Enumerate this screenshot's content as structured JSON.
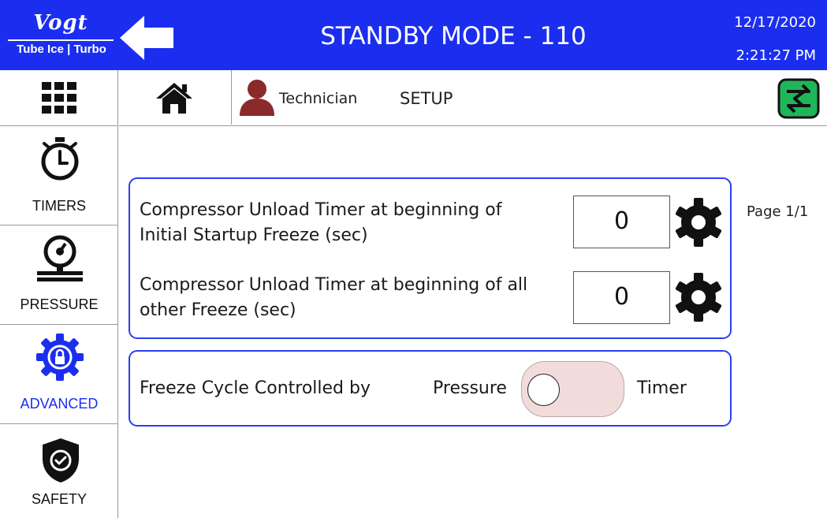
{
  "header": {
    "logo_brand": "Vogt",
    "logo_sub": "Tube Ice | Turbo",
    "title": "STANDBY MODE - 110",
    "date": "12/17/2020",
    "time": "2:21:27 PM",
    "color": "#1b2ef0"
  },
  "sidebar": {
    "grid_icon": "menu-grid-icon",
    "items": [
      {
        "label": "TIMERS",
        "icon": "stopwatch-icon",
        "selected": false
      },
      {
        "label": "PRESSURE",
        "icon": "pressure-gauge-icon",
        "selected": false
      },
      {
        "label": "ADVANCED",
        "icon": "lock-gear-icon",
        "selected": true
      },
      {
        "label": "SAFETY",
        "icon": "shield-check-icon",
        "selected": false
      }
    ]
  },
  "navbar": {
    "home_icon": "home-icon",
    "user_icon": "user-icon",
    "user_label": "Technician",
    "section_label": "SETUP",
    "swap_icon": "swap-screen-icon"
  },
  "settings": {
    "rows": [
      {
        "label_line1": "Compressor Unload Timer at beginning of",
        "label_line2": "Initial Startup Freeze (sec)",
        "value": "0"
      },
      {
        "label_line1": "Compressor Unload Timer at beginning of all",
        "label_line2": "other Freeze (sec)",
        "value": "0"
      }
    ],
    "page": "Page 1/1"
  },
  "freeze_cycle": {
    "label": "Freeze Cycle Controlled by",
    "option_left": "Pressure",
    "option_right": "Timer",
    "selected": "Pressure",
    "toggle_color": "#f2dcdb"
  },
  "colors": {
    "accent": "#1b2ef0",
    "panel_border": "#2b3ff2",
    "user_icon": "#8b2a2a",
    "swap_icon": "#1fb65a"
  }
}
